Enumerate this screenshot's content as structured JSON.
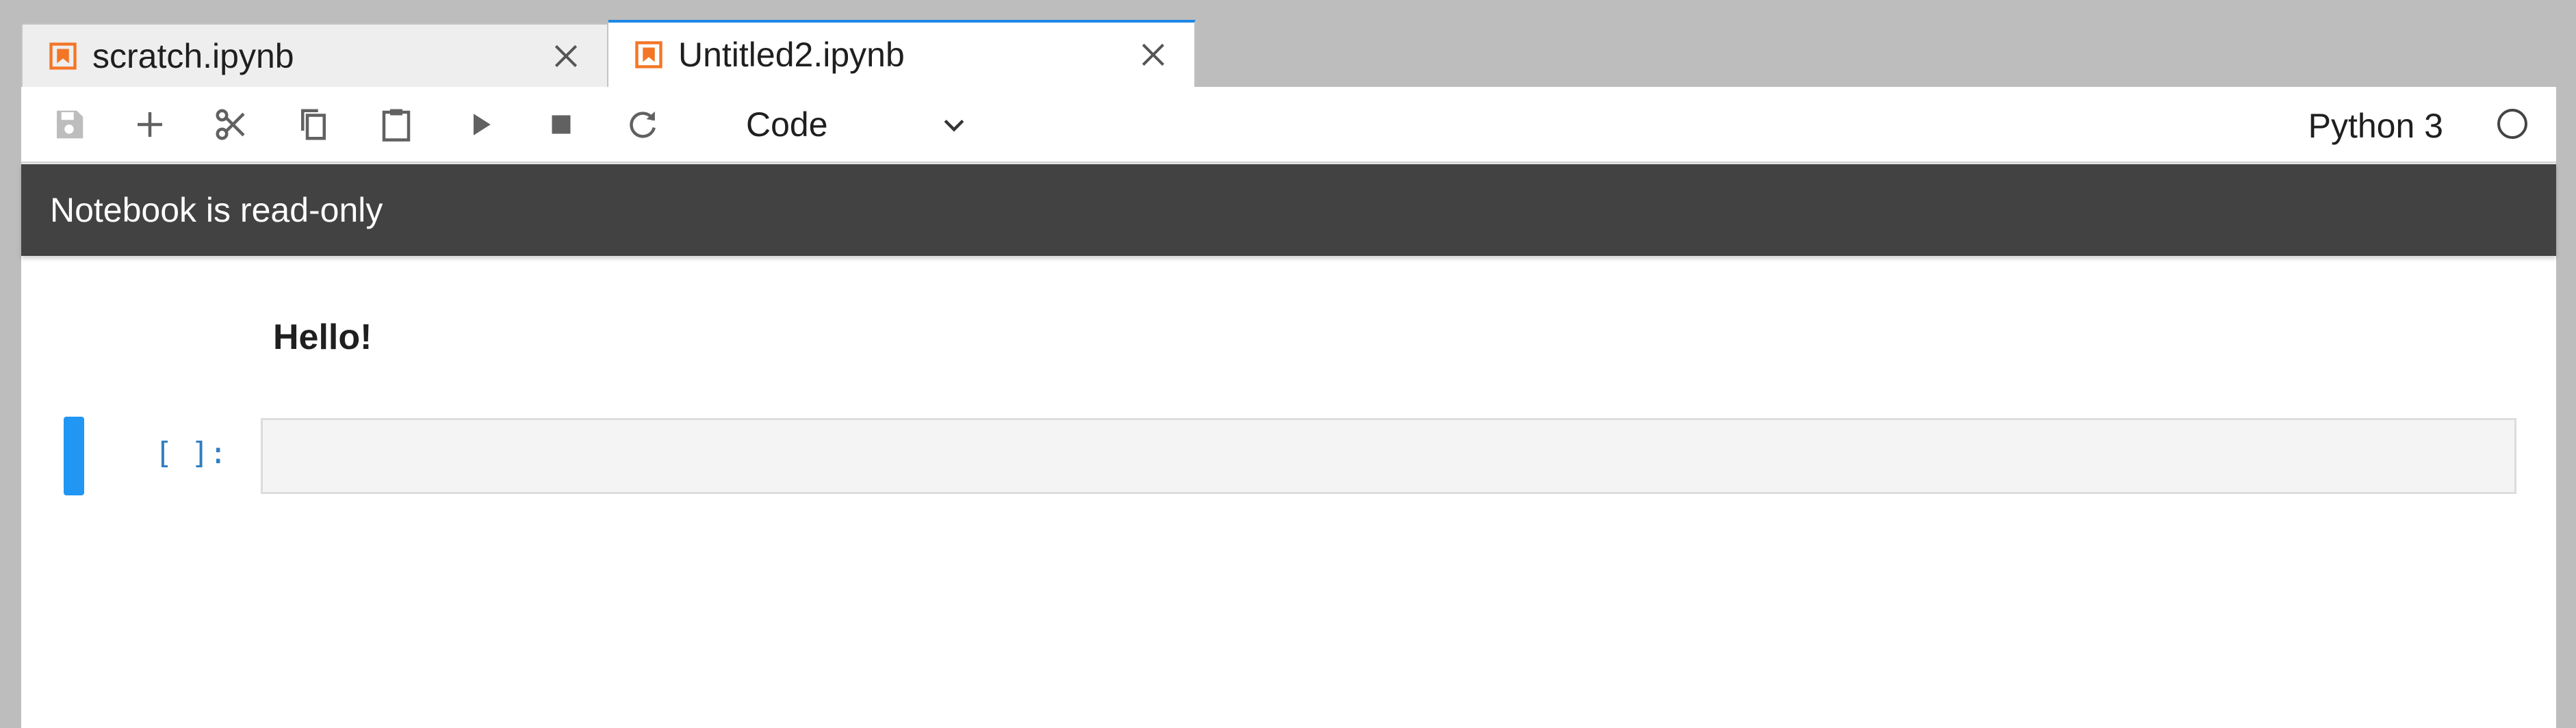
{
  "tabs": [
    {
      "label": "scratch.ipynb",
      "active": false,
      "icon": "notebook-icon"
    },
    {
      "label": "Untitled2.ipynb",
      "active": true,
      "icon": "notebook-icon"
    }
  ],
  "toolbar": {
    "buttons": [
      "save-icon",
      "add-icon",
      "cut-icon",
      "copy-icon",
      "paste-icon",
      "run-icon",
      "stop-icon",
      "restart-icon"
    ],
    "cell_type": "Code",
    "kernel_name": "Python 3",
    "kernel_status": "idle"
  },
  "banner": {
    "text": "Notebook is read-only"
  },
  "notebook": {
    "markdown_text": "Hello!",
    "code_prompt": "[ ]:",
    "code_value": ""
  },
  "colors": {
    "accent": "#1e88e5",
    "active_cell": "#2196f3",
    "notebook_icon": "#f37626",
    "banner_bg": "#424242",
    "prompt": "#307fc1"
  }
}
